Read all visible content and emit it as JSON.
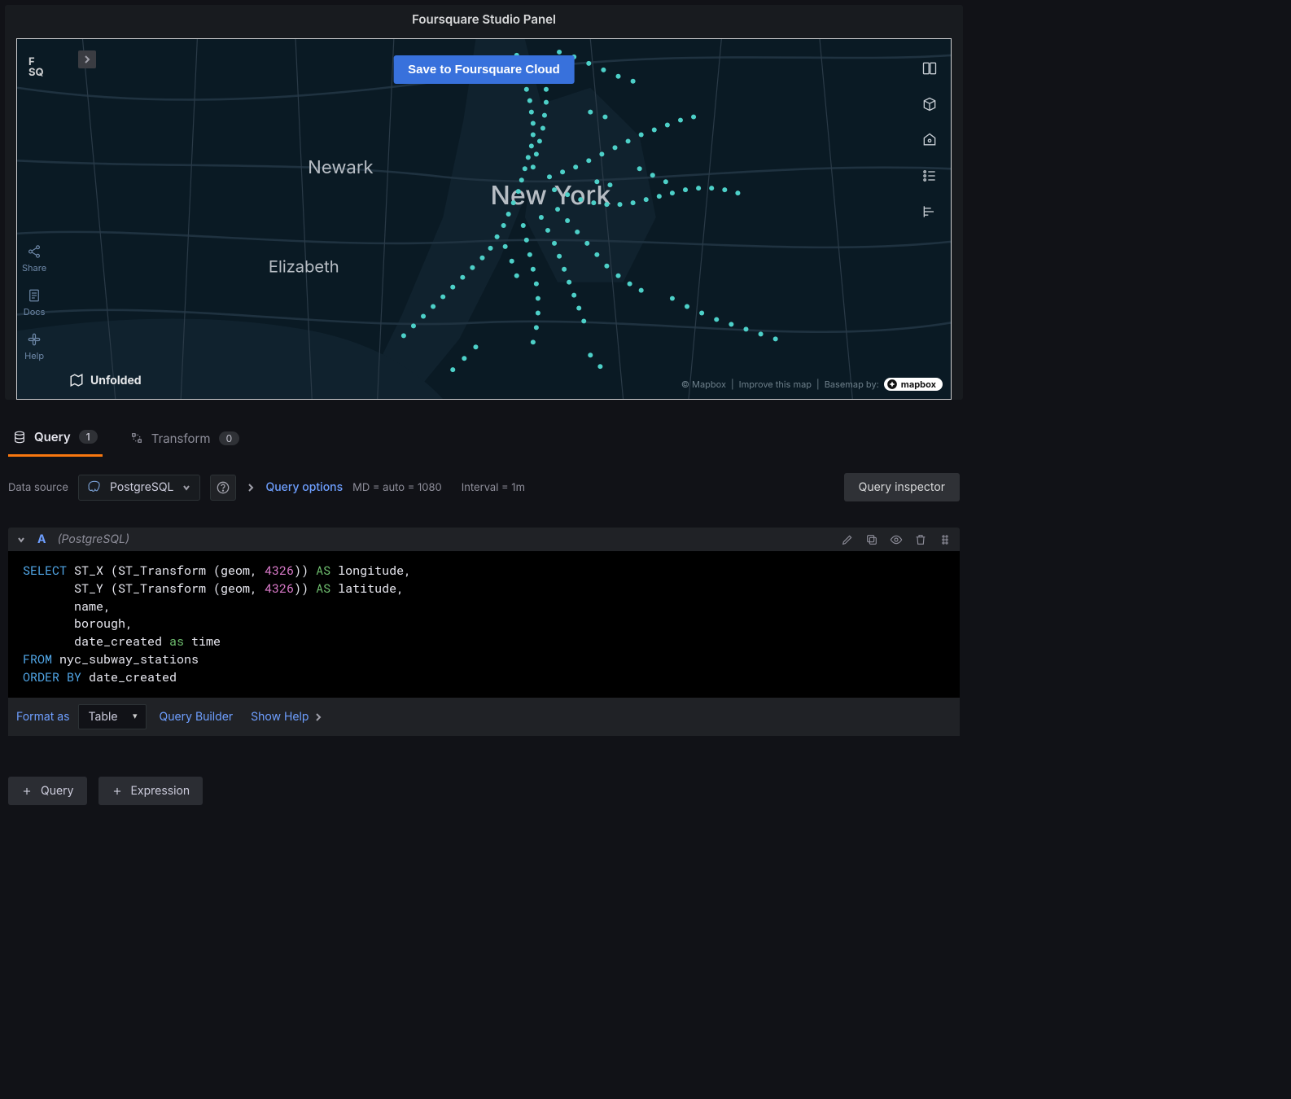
{
  "panel": {
    "title": "Foursquare Studio Panel"
  },
  "map": {
    "save_button": "Save to Foursquare Cloud",
    "logo_line1": "F",
    "logo_line2": "SQ",
    "unfolded": "Unfolded",
    "labels": {
      "newyork": "New York",
      "newark": "Newark",
      "elizabeth": "Elizabeth"
    },
    "attribution": {
      "copyright": "© Mapbox",
      "improve": "Improve this map",
      "basemap_by": "Basemap by:",
      "mapbox": "mapbox"
    },
    "left_rail": {
      "share": "Share",
      "docs": "Docs",
      "help": "Help"
    }
  },
  "tabs": {
    "query": {
      "label": "Query",
      "count": "1"
    },
    "transform": {
      "label": "Transform",
      "count": "0"
    }
  },
  "datasource": {
    "label": "Data source",
    "selected": "PostgreSQL",
    "query_options": "Query options",
    "md": "MD = auto = 1080",
    "interval": "Interval = 1m",
    "inspector": "Query inspector"
  },
  "query": {
    "letter": "A",
    "ds_name": "(PostgreSQL)",
    "format_label": "Format as",
    "format_value": "Table",
    "builder": "Query Builder",
    "show_help": "Show Help",
    "sql": {
      "l1a": "SELECT",
      "l1b": " ST_X (ST_Transform (geom, ",
      "l1num": "4326",
      "l1c": ")) ",
      "l1as": "AS",
      "l1d": " longitude,",
      "l2a": "       ST_Y (ST_Transform (geom, ",
      "l2num": "4326",
      "l2b": ")) ",
      "l2as": "AS",
      "l2c": " latitude,",
      "l3": "       name,",
      "l4": "       borough,",
      "l5a": "       date_created ",
      "l5as": "as",
      "l5b": " time",
      "l6a": "FROM",
      "l6b": " nyc_subway_stations",
      "l7a": "ORDER BY",
      "l7b": " date_created"
    }
  },
  "footer": {
    "add_query": "Query",
    "add_expr": "Expression"
  }
}
